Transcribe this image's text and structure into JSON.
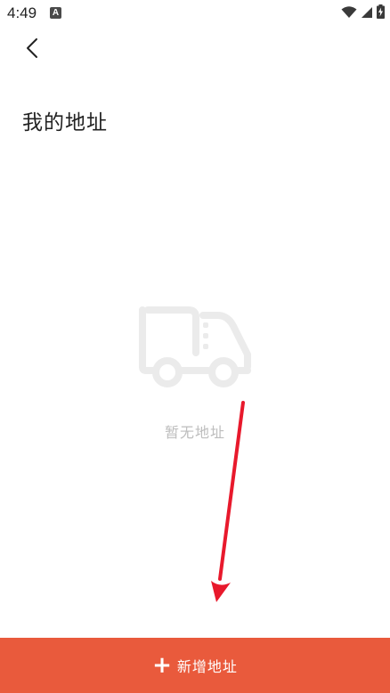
{
  "status_bar": {
    "time": "4:49",
    "app_icon_letter": "A",
    "icons": [
      "wifi-icon",
      "signal-icon",
      "battery-charging-icon"
    ]
  },
  "nav": {
    "back_icon": "chevron-left-icon"
  },
  "header": {
    "title": "我的地址"
  },
  "empty_state": {
    "icon": "delivery-truck-icon",
    "message": "暂无地址"
  },
  "annotation": {
    "type": "arrow",
    "color": "#e8192c"
  },
  "bottom_action": {
    "icon": "plus-icon",
    "icon_glyph": "+",
    "label": "新增地址"
  },
  "colors": {
    "accent": "#e95a3c",
    "title_text": "#222222",
    "empty_text": "#bdbdbd",
    "illustration": "#ebebeb"
  }
}
